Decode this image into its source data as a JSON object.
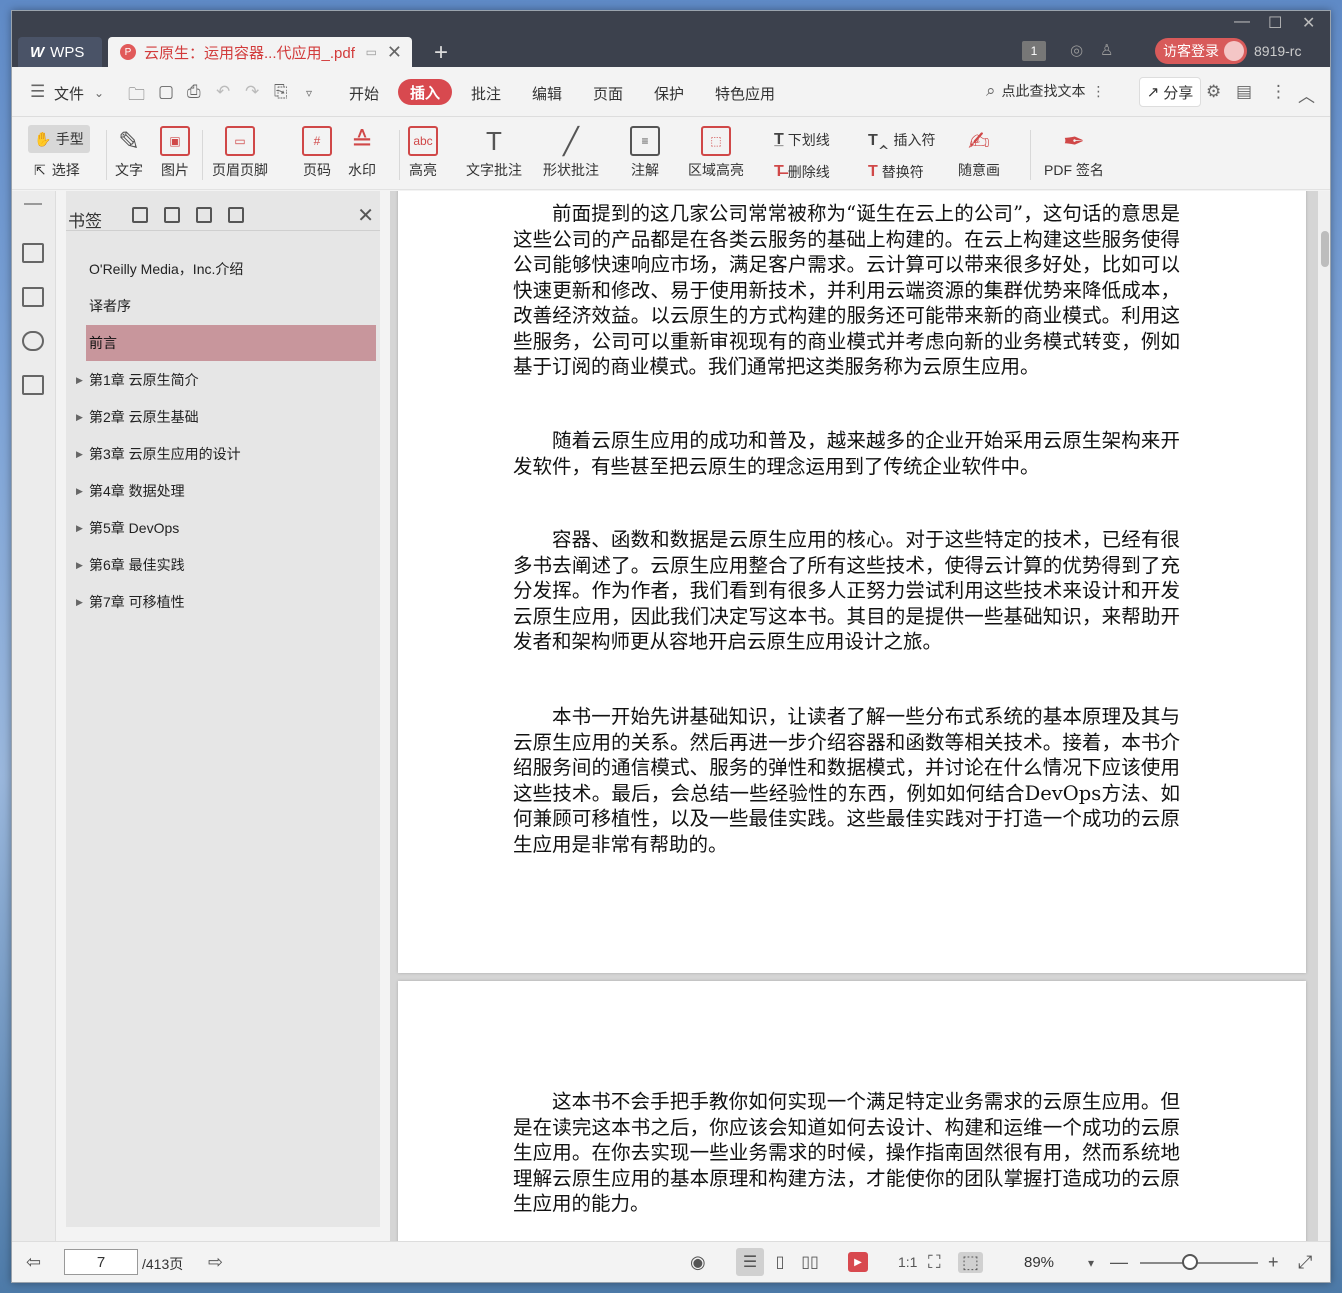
{
  "titlebar": {
    "app_name": "WPS",
    "doc_tab_title": "云原生：运用容器...代应用_.pdf",
    "badge_count": "1",
    "login_label": "访客登录",
    "user_code": "8919-rc"
  },
  "menubar": {
    "file": "文件",
    "items": [
      "开始",
      "插入",
      "批注",
      "编辑",
      "页面",
      "保护",
      "特色应用"
    ],
    "active": "插入",
    "search_label": "点此查找文本",
    "share_label": "分享"
  },
  "toolbar": {
    "hand": "手型",
    "select": "选择",
    "tools": [
      "文字",
      "图片",
      "页眉页脚",
      "页码",
      "水印",
      "高亮",
      "文字批注",
      "形状批注",
      "注解",
      "区域高亮"
    ],
    "underline": "下划线",
    "strikethrough": "删除线",
    "insert_mark": "插入符",
    "replace_mark": "替换符",
    "freehand": "随意画",
    "pdf_sign": "PDF 签名"
  },
  "bookmarks": {
    "title": "书签",
    "items": [
      {
        "label": "O'Reilly Media，Inc.介绍",
        "expandable": false
      },
      {
        "label": "译者序",
        "expandable": false
      },
      {
        "label": "前言",
        "expandable": false,
        "active": true
      },
      {
        "label": "第1章 云原生简介",
        "expandable": true
      },
      {
        "label": "第2章 云原生基础",
        "expandable": true
      },
      {
        "label": "第3章 云原生应用的设计",
        "expandable": true
      },
      {
        "label": "第4章 数据处理",
        "expandable": true
      },
      {
        "label": "第5章 DevOps",
        "expandable": true
      },
      {
        "label": "第6章 最佳实践",
        "expandable": true
      },
      {
        "label": "第7章 可移植性",
        "expandable": true
      }
    ]
  },
  "document": {
    "page1": [
      "前面提到的这几家公司常常被称为“诞生在云上的公司”，这句话的意思是这些公司的产品都是在各类云服务的基础上构建的。在云上构建这些服务使得公司能够快速响应市场，满足客户需求。云计算可以带来很多好处，比如可以快速更新和修改、易于使用新技术，并利用云端资源的集群优势来降低成本，改善经济效益。以云原生的方式构建的服务还可能带来新的商业模式。利用这些服务，公司可以重新审视现有的商业模式并考虑向新的业务模式转变，例如基于订阅的商业模式。我们通常把这类服务称为云原生应用。",
      "随着云原生应用的成功和普及，越来越多的企业开始采用云原生架构来开发软件，有些甚至把云原生的理念运用到了传统企业软件中。",
      "容器、函数和数据是云原生应用的核心。对于这些特定的技术，已经有很多书去阐述了。云原生应用整合了所有这些技术，使得云计算的优势得到了充分发挥。作为作者，我们看到有很多人正努力尝试利用这些技术来设计和开发云原生应用，因此我们决定写这本书。其目的是提供一些基础知识，来帮助开发者和架构师更从容地开启云原生应用设计之旅。",
      "本书一开始先讲基础知识，让读者了解一些分布式系统的基本原理及其与云原生应用的关系。然后再进一步介绍容器和函数等相关技术。接着，本书介绍服务间的通信模式、服务的弹性和数据模式，并讨论在什么情况下应该使用这些技术。最后，会总结一些经验性的东西，例如如何结合DevOps方法、如何兼顾可移植性，以及一些最佳实践。这些最佳实践对于打造一个成功的云原生应用是非常有帮助的。"
    ],
    "page2": [
      "这本书不会手把手教你如何实现一个满足特定业务需求的云原生应用。但是在读完这本书之后，你应该会知道如何去设计、构建和运维一个成功的云原生应用。在你去实现一些业务需求的时候，操作指南固然很有用，然而系统地理解云原生应用的基本原理和构建方法，才能使你的团队掌握打造成功的云原生应用的能力。"
    ]
  },
  "statusbar": {
    "current_page": "7",
    "total_pages": "/413页",
    "zoom": "89%"
  }
}
